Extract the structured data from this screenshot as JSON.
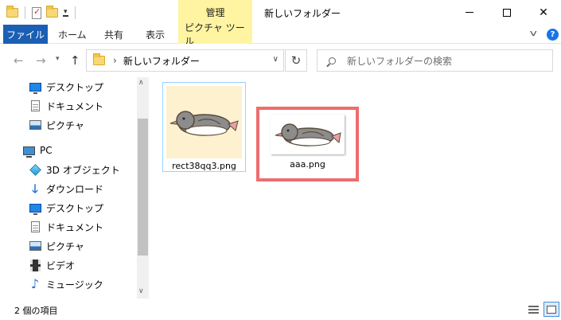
{
  "window": {
    "title": "新しいフォルダー",
    "context_tab": "管理"
  },
  "ribbon": {
    "tabs": [
      "ファイル",
      "ホーム",
      "共有",
      "表示",
      "ピクチャ ツール"
    ],
    "help": "?"
  },
  "address": {
    "path_segment": "新しいフォルダー",
    "separator": "›",
    "search_placeholder": "新しいフォルダーの検索"
  },
  "nav": {
    "items": [
      {
        "label": "デスクトップ",
        "icon": "desktop-icon"
      },
      {
        "label": "ドキュメント",
        "icon": "document-icon"
      },
      {
        "label": "ピクチャ",
        "icon": "pictures-icon"
      },
      {
        "label": "PC",
        "icon": "pc-icon"
      },
      {
        "label": "3D オブジェクト",
        "icon": "3d-objects-icon"
      },
      {
        "label": "ダウンロード",
        "icon": "download-icon"
      },
      {
        "label": "デスクトップ",
        "icon": "desktop-icon"
      },
      {
        "label": "ドキュメント",
        "icon": "document-icon"
      },
      {
        "label": "ピクチャ",
        "icon": "pictures-icon"
      },
      {
        "label": "ビデオ",
        "icon": "video-icon"
      },
      {
        "label": "ミュージック",
        "icon": "music-icon"
      }
    ]
  },
  "files": [
    {
      "name": "rect38qq3.png",
      "state": "hover"
    },
    {
      "name": "aaa.png",
      "state": "highlighted"
    }
  ],
  "status": {
    "item_count": "2 個の項目"
  },
  "colors": {
    "file_tab": "#1a5fb4",
    "context_tab": "#fff4a1",
    "highlight_border": "#ee6d6d",
    "thumb1_bg": "#fdf1cf"
  }
}
